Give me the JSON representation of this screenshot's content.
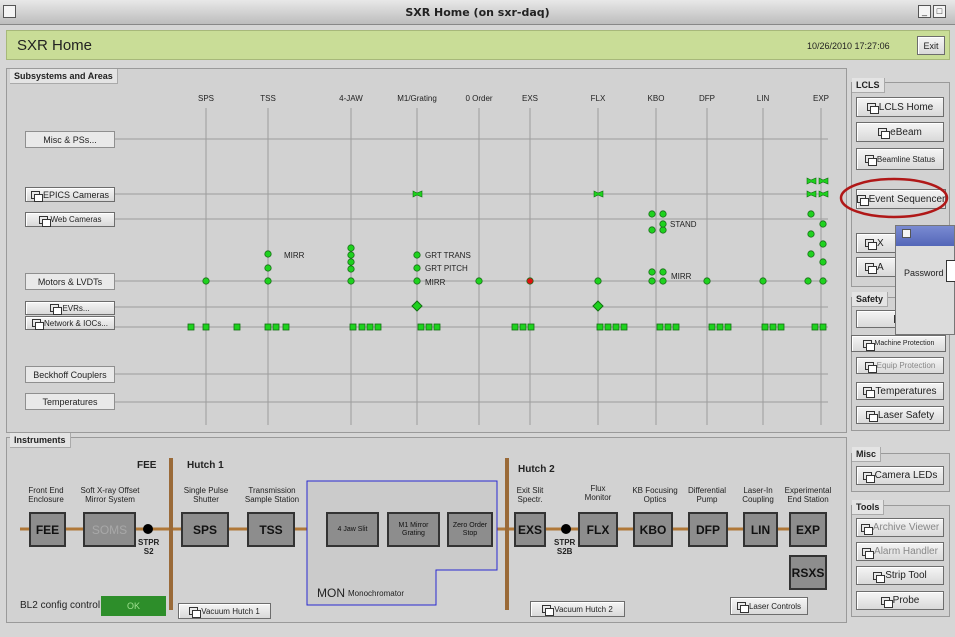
{
  "window": {
    "title": "SXR Home (on sxr-daq)"
  },
  "header": {
    "title": "SXR Home",
    "datetime": "10/26/2010 17:27:06",
    "exit_label": "Exit"
  },
  "subsystems": {
    "title": "Subsystems and Areas",
    "columns": [
      "SPS",
      "TSS",
      "4-JAW",
      "M1/Grating",
      "0 Order",
      "EXS",
      "FLX",
      "KBO",
      "DFP",
      "LIN",
      "EXP"
    ],
    "rows": {
      "misc": "Misc & PSs...",
      "epics": "EPICS Cameras",
      "web": "Web Cameras",
      "motors": "Motors & LVDTs",
      "evrs": "EVRs...",
      "network": "Network & IOCs...",
      "beckhoff": "Beckhoff Couplers",
      "temps": "Temperatures"
    },
    "annotations": {
      "mirr1": "MIRR",
      "grt_trans": "GRT TRANS",
      "grt_pitch": "GRT PITCH",
      "mirr2": "MIRR",
      "stand": "STAND",
      "mirr3": "MIRR"
    }
  },
  "lcls": {
    "title": "LCLS",
    "buttons": [
      "LCLS Home",
      "eBeam",
      "Beamline Status",
      "Event Sequencer",
      "X",
      "A"
    ]
  },
  "safety": {
    "title": "Safety",
    "buttons": [
      "",
      "Machine Protection",
      "Equip Protection",
      "Temperatures",
      "Laser Safety"
    ]
  },
  "misc": {
    "title": "Misc",
    "buttons": [
      "Camera LEDs"
    ]
  },
  "tools": {
    "title": "Tools",
    "buttons": [
      "Archive Viewer",
      "Alarm Handler",
      "Strip Tool",
      "Probe"
    ]
  },
  "dialog": {
    "password_label": "Password"
  },
  "instruments": {
    "title": "Instruments",
    "fee_label": "FEE",
    "hutch1": "Hutch 1",
    "hutch2": "Hutch 2",
    "boxes": {
      "fee": {
        "label": "FEE",
        "desc": "Front End\nEnclosure"
      },
      "soms": {
        "label": "SOMS",
        "desc": "Soft X-ray Offset\nMirror System"
      },
      "sps": {
        "label": "SPS",
        "desc": "Single Pulse\nShutter"
      },
      "tss": {
        "label": "TSS",
        "desc": "Transmission\nSample Station"
      },
      "jaw": {
        "label": "4 Jaw Slit"
      },
      "m1": {
        "label": "M1 Mirror\nGrating"
      },
      "zero": {
        "label": "Zero Order\nStop"
      },
      "exs": {
        "label": "EXS",
        "desc": "Exit Slit\nSpectr."
      },
      "flx": {
        "label": "FLX",
        "desc": "Flux\nMonitor"
      },
      "kbo": {
        "label": "KBO",
        "desc": "KB Focusing\nOptics"
      },
      "dfp": {
        "label": "DFP",
        "desc": "Differential\nPump"
      },
      "lin": {
        "label": "LIN",
        "desc": "Laser-In\nCoupling"
      },
      "exp": {
        "label": "EXP",
        "desc": "Experimental\nEnd Station"
      },
      "rsxs": {
        "label": "RSXS"
      }
    },
    "stpr1": "STPR\nS2",
    "stpr2": "STPR\nS2B",
    "mon_label": "MON",
    "mon_desc": "Monochromator",
    "bl2_label": "BL2 config control",
    "ok_label": "OK",
    "vac1": "Vacuum Hutch 1",
    "vac2": "Vacuum Hutch 2",
    "laser_controls": "Laser Controls"
  }
}
